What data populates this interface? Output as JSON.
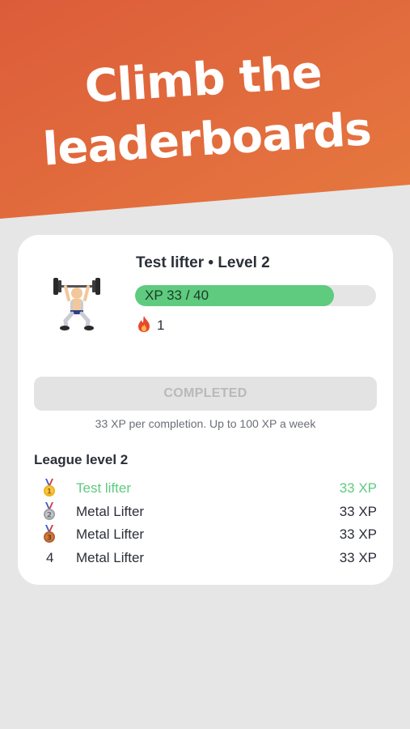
{
  "hero": {
    "headline_line1": "Climb the",
    "headline_line2": "leaderboards",
    "gradient_start": "#dc5c3a",
    "gradient_end": "#e6793f"
  },
  "profile": {
    "title": "Test lifter • Level 2",
    "avatar_icon": "weightlifter-icon",
    "xp_label": "XP 33 / 40",
    "xp_current": 33,
    "xp_max": 40,
    "streak_icon": "fire-icon",
    "streak_count": "1"
  },
  "completion": {
    "button_label": "COMPLETED",
    "note": "33 XP per completion. Up to 100 XP a week"
  },
  "league": {
    "title": "League level 2",
    "rows": [
      {
        "rank_icon": "gold-medal-icon",
        "rank_text": "",
        "name": "Test lifter",
        "xp": "33 XP",
        "is_current_user": true
      },
      {
        "rank_icon": "silver-medal-icon",
        "rank_text": "",
        "name": "Metal Lifter",
        "xp": "33 XP",
        "is_current_user": false
      },
      {
        "rank_icon": "bronze-medal-icon",
        "rank_text": "",
        "name": "Metal Lifter",
        "xp": "33 XP",
        "is_current_user": false
      },
      {
        "rank_icon": "",
        "rank_text": "4",
        "name": "Metal Lifter",
        "xp": "33 XP",
        "is_current_user": false
      }
    ]
  },
  "colors": {
    "accent_green": "#5ecb7f",
    "card_bg": "#ffffff",
    "page_bg": "#e6e6e6"
  }
}
